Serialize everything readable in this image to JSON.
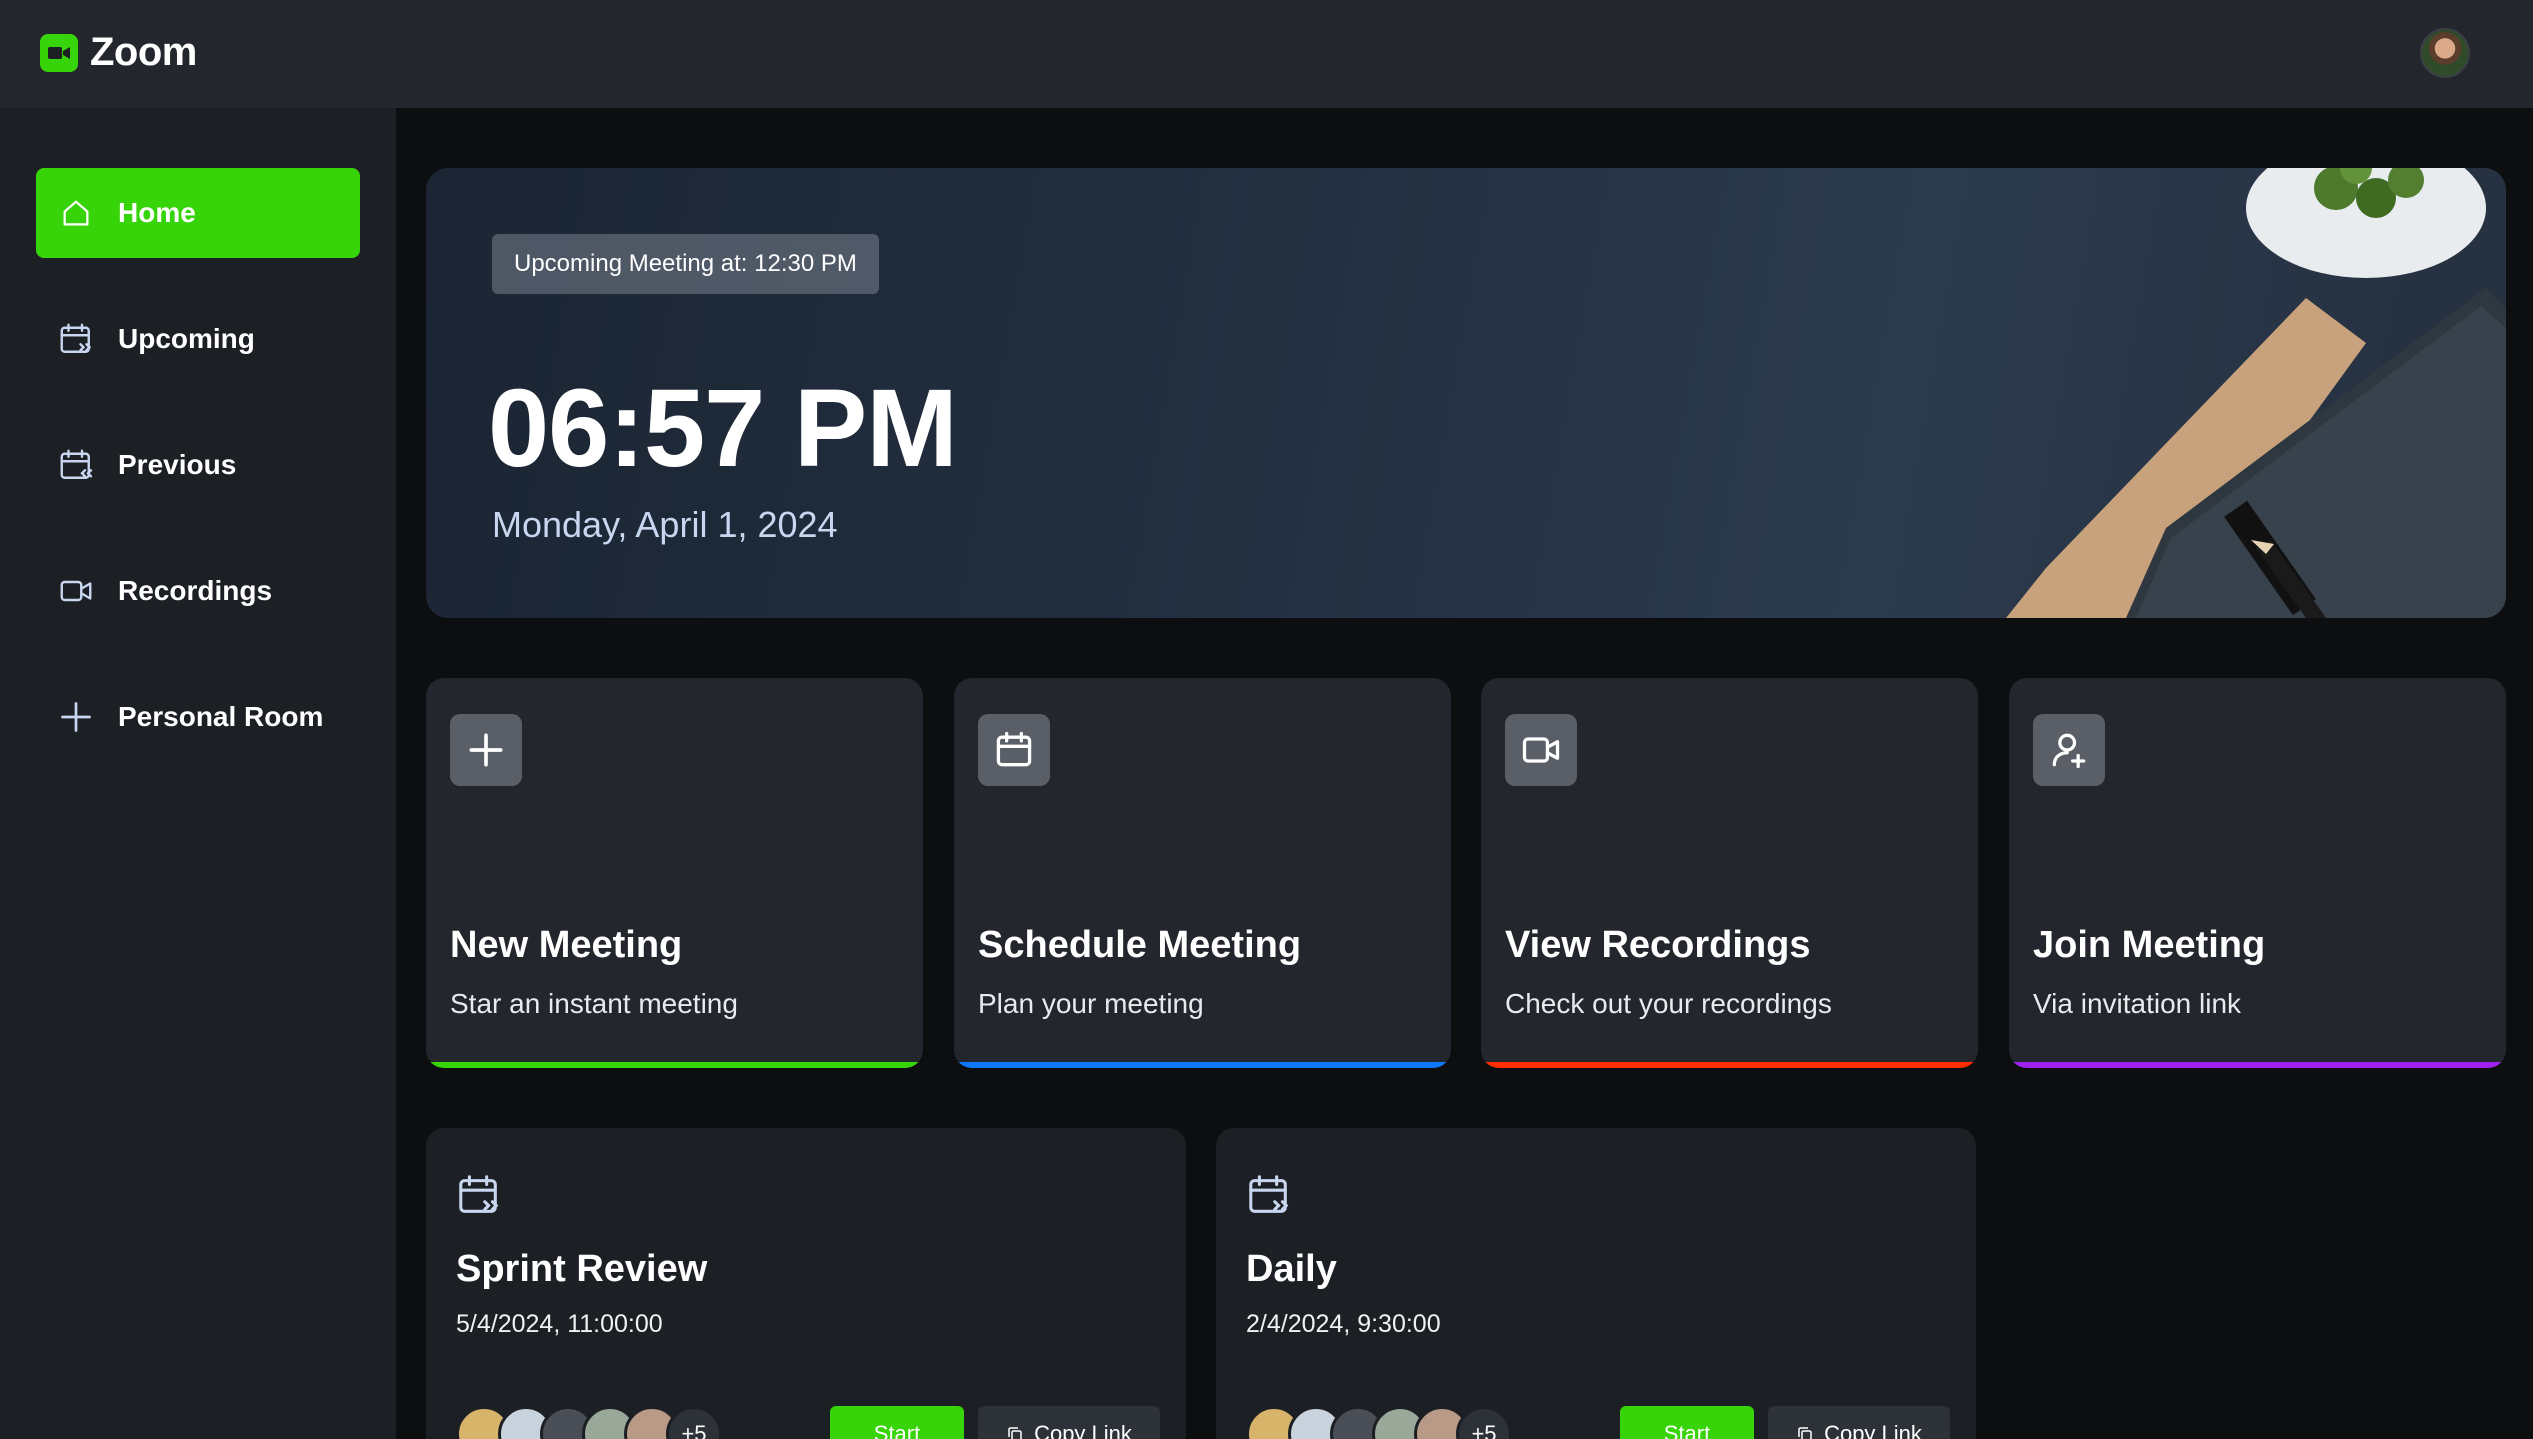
{
  "app": {
    "title": "Zoom",
    "logo_icon": "video-camera-icon",
    "accent_color": "#38d40a"
  },
  "sidebar": {
    "items": [
      {
        "label": "Home",
        "icon": "home-icon",
        "active": true
      },
      {
        "label": "Upcoming",
        "icon": "calendar-forward-icon",
        "active": false
      },
      {
        "label": "Previous",
        "icon": "calendar-back-icon",
        "active": false
      },
      {
        "label": "Recordings",
        "icon": "video-icon",
        "active": false
      },
      {
        "label": "Personal Room",
        "icon": "plus-icon",
        "active": false
      }
    ]
  },
  "hero": {
    "badge": "Upcoming Meeting at: 12:30 PM",
    "time": "06:57 PM",
    "date": "Monday, April 1, 2024"
  },
  "actions": [
    {
      "title": "New Meeting",
      "description": "Star an instant meeting",
      "icon": "plus-icon",
      "color": "#38d40a"
    },
    {
      "title": "Schedule Meeting",
      "description": "Plan your meeting",
      "icon": "calendar-icon",
      "color": "#0e78f9"
    },
    {
      "title": "View Recordings",
      "description": "Check out your recordings",
      "icon": "video-icon",
      "color": "#ff2d00"
    },
    {
      "title": "Join Meeting",
      "description": "Via invitation link",
      "icon": "user-plus-icon",
      "color": "#a020f0"
    }
  ],
  "meetings": [
    {
      "title": "Sprint Review",
      "datetime": "5/4/2024, 11:00:00",
      "extra_attendees": "+5",
      "start_label": "Start",
      "copy_label": "Copy Link"
    },
    {
      "title": "Daily",
      "datetime": "2/4/2024, 9:30:00",
      "extra_attendees": "+5",
      "start_label": "Start",
      "copy_label": "Copy Link"
    }
  ]
}
